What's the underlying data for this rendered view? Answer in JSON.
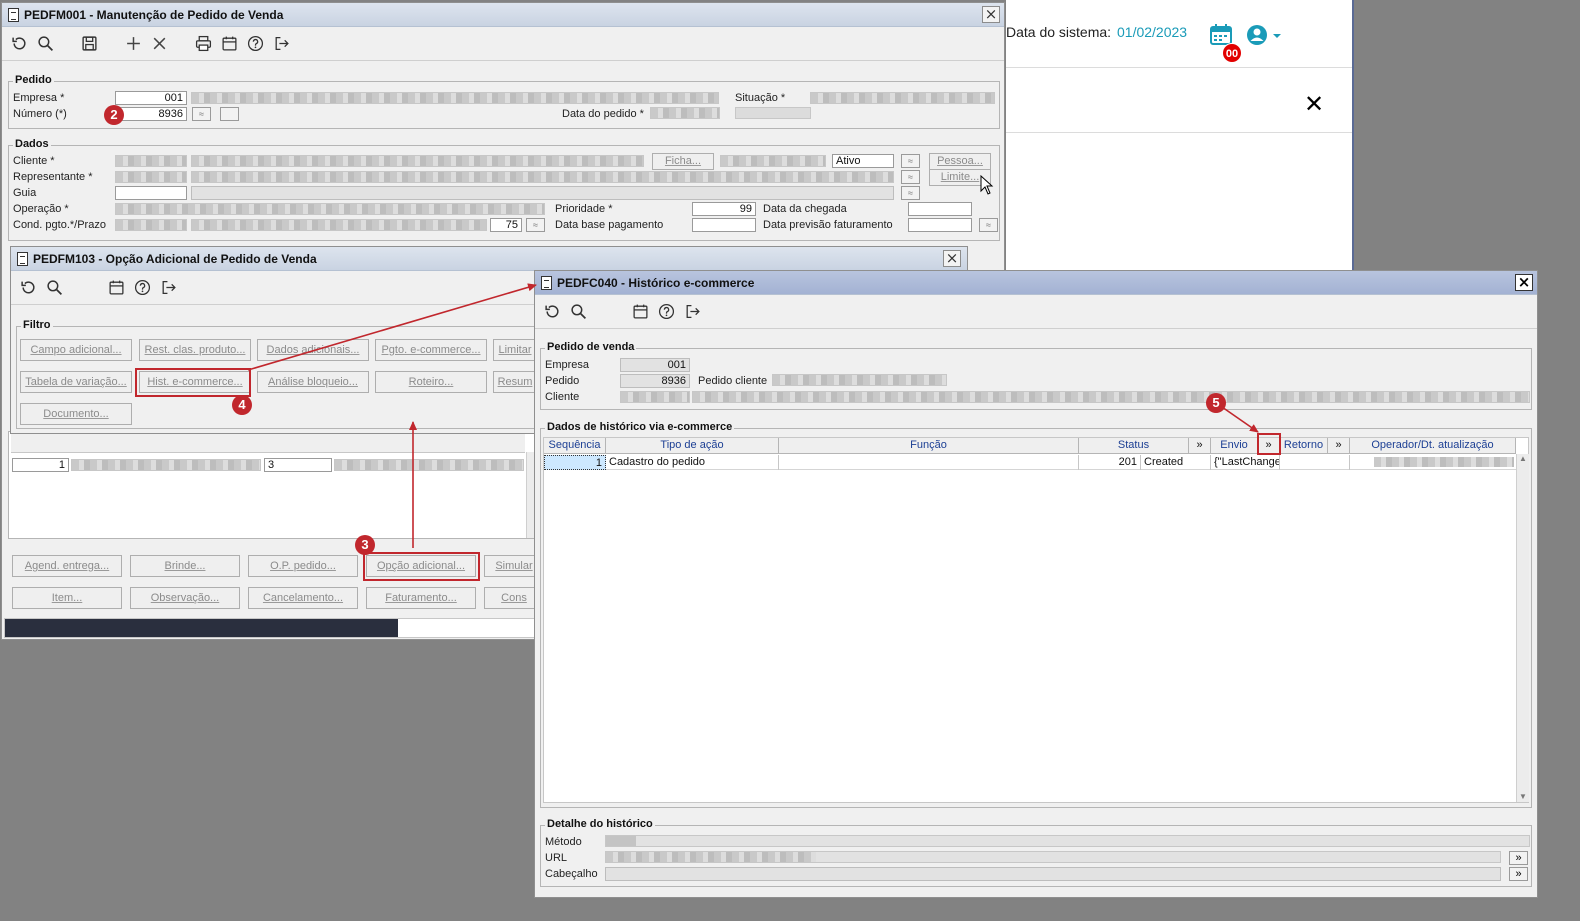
{
  "top_app": {
    "system_date_label": "Data do sistema:",
    "system_date_value": "01/02/2023",
    "calendar_badge": "00"
  },
  "win1": {
    "title": "PEDFM001 - Manutenção de Pedido de Venda",
    "pedido": {
      "group": "Pedido",
      "empresa_label": "Empresa *",
      "empresa_value": "001",
      "numero_label": "Número (*)",
      "numero_value": "8936",
      "situacao_label": "Situação *",
      "data_pedido_label": "Data do pedido *"
    },
    "dados": {
      "group": "Dados",
      "cliente_label": "Cliente *",
      "representante_label": "Representante *",
      "guia_label": "Guia",
      "operacao_label": "Operação *",
      "cond_label": "Cond. pgto.*/Prazo",
      "prazo_value": "75",
      "ficha_btn": "Ficha...",
      "ativo_value": "Ativo",
      "pessoa_btn": "Pessoa...",
      "limite_btn": "Limite...",
      "prioridade_label": "Prioridade *",
      "prioridade_value": "99",
      "data_base_label": "Data base pagamento",
      "data_chegada_label": "Data da chegada",
      "data_previsao_label": "Data previsão faturamento"
    },
    "grid_row": {
      "col1": "1",
      "col3": "3"
    },
    "bottom_buttons_row1": [
      "Agend. entrega...",
      "Brinde...",
      "O.P. pedido...",
      "Opção adicional...",
      "Simular"
    ],
    "bottom_buttons_row2": [
      "Item...",
      "Observação...",
      "Cancelamento...",
      "Faturamento...",
      "Cons"
    ]
  },
  "win2": {
    "title": "PEDFM103 - Opção Adicional de Pedido de Venda",
    "filtro_group": "Filtro",
    "buttons_row1": [
      "Campo adicional...",
      "Rest. clas. produto...",
      "Dados adicionais...",
      "Pgto. e-commerce...",
      "Limitar"
    ],
    "buttons_row2": [
      "Tabela de variação...",
      "Hist. e-commerce...",
      "Análise bloqueio...",
      "Roteiro...",
      "Resum"
    ],
    "buttons_row3": [
      "Documento..."
    ]
  },
  "win3": {
    "title": "PEDFC040 - Histórico e-commerce",
    "pedido_venda": {
      "group": "Pedido de venda",
      "empresa_label": "Empresa",
      "empresa_value": "001",
      "pedido_label": "Pedido",
      "pedido_value": "8936",
      "pedido_cliente_label": "Pedido cliente",
      "cliente_label": "Cliente"
    },
    "historico": {
      "group": "Dados de histórico via e-commerce",
      "columns": [
        "Sequência",
        "Tipo de ação",
        "Função",
        "Status",
        "»",
        "Envio",
        "»",
        "Retorno",
        "»",
        "Operador/Dt. atualização"
      ],
      "rows": [
        {
          "seq": "1",
          "tipo": "Cadastro do pedido",
          "funcao": "",
          "status_code": "201",
          "status_text": "Created",
          "envio": "{\"LastChange",
          "retorno": ""
        }
      ]
    },
    "detalhe": {
      "group": "Detalhe do histórico",
      "metodo_label": "Método",
      "url_label": "URL",
      "cabecalho_label": "Cabeçalho",
      "expand_glyph": "»"
    }
  },
  "annotations": [
    "2",
    "3",
    "4",
    "5"
  ],
  "colors": {
    "annotation_red": "#c1272d",
    "accent_teal": "#1a9bb8",
    "selection_blue": "#cde8ff",
    "header_text_blue": "#1c3f94"
  },
  "icons": [
    "refresh-icon",
    "search-icon",
    "save-icon",
    "add-icon",
    "delete-icon",
    "print-icon",
    "calendar-icon",
    "help-icon",
    "exit-icon",
    "user-icon",
    "close-icon"
  ]
}
